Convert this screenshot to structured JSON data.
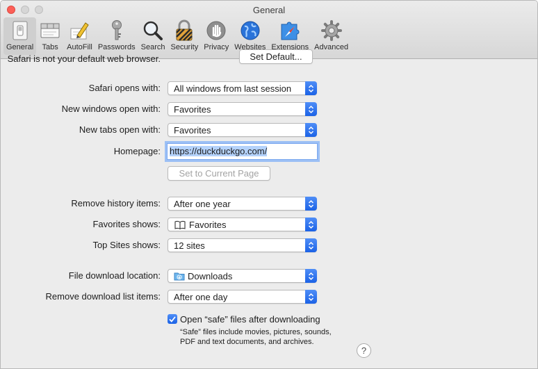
{
  "window": {
    "title": "General"
  },
  "toolbar": {
    "items": [
      {
        "label": "General",
        "icon": "general-switch-icon",
        "selected": true
      },
      {
        "label": "Tabs",
        "icon": "tabs-icon"
      },
      {
        "label": "AutoFill",
        "icon": "pencil-icon"
      },
      {
        "label": "Passwords",
        "icon": "key-icon"
      },
      {
        "label": "Search",
        "icon": "magnifier-icon"
      },
      {
        "label": "Security",
        "icon": "padlock-icon"
      },
      {
        "label": "Privacy",
        "icon": "hand-icon"
      },
      {
        "label": "Websites",
        "icon": "globe-icon"
      },
      {
        "label": "Extensions",
        "icon": "puzzle-compass-icon"
      },
      {
        "label": "Advanced",
        "icon": "gear-icon"
      }
    ]
  },
  "default_browser": {
    "text": "Safari is not your default web browser.",
    "button": "Set Default..."
  },
  "form": {
    "opens_with": {
      "label": "Safari opens with:",
      "value": "All windows from last session"
    },
    "new_windows": {
      "label": "New windows open with:",
      "value": "Favorites"
    },
    "new_tabs": {
      "label": "New tabs open with:",
      "value": "Favorites"
    },
    "homepage": {
      "label": "Homepage:",
      "value": "https://duckduckgo.com/"
    },
    "set_current_page": "Set to Current Page",
    "remove_history": {
      "label": "Remove history items:",
      "value": "After one year"
    },
    "favorites_shows": {
      "label": "Favorites shows:",
      "value": "Favorites",
      "icon": "book-icon"
    },
    "top_sites": {
      "label": "Top Sites shows:",
      "value": "12 sites"
    },
    "download_location": {
      "label": "File download location:",
      "value": "Downloads",
      "icon": "downloads-folder-icon"
    },
    "remove_downloads": {
      "label": "Remove download list items:",
      "value": "After one day"
    },
    "open_safe": {
      "label": "Open “safe” files after downloading",
      "checked": true,
      "note": "“Safe” files include movies, pictures, sounds, PDF and text documents, and archives."
    },
    "help": "?"
  },
  "colors": {
    "accent": "#2a6ff0",
    "selection": "#b4d2fb",
    "window_bg": "#ececec"
  }
}
